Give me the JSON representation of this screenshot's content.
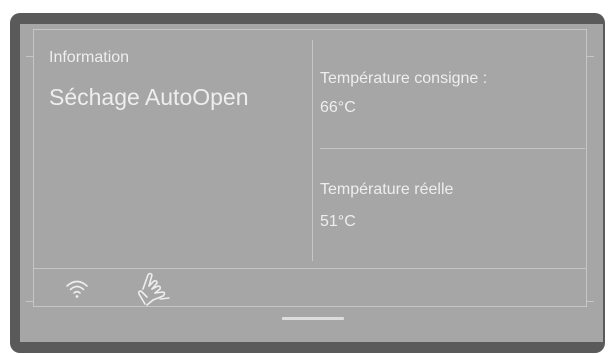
{
  "info": {
    "label": "Information",
    "title": "Séchage AutoOpen"
  },
  "target": {
    "label": "Température consigne :",
    "value": "66°C"
  },
  "actual": {
    "label": "Température réelle",
    "value": "51°C"
  },
  "status_icons": [
    "wifi-icon",
    "hand-touch-icon"
  ],
  "colors": {
    "bezel": "#5a5a5a",
    "screen": "#a6a6a6",
    "text": "#eeeeee",
    "lines": "#c6c6c6"
  }
}
